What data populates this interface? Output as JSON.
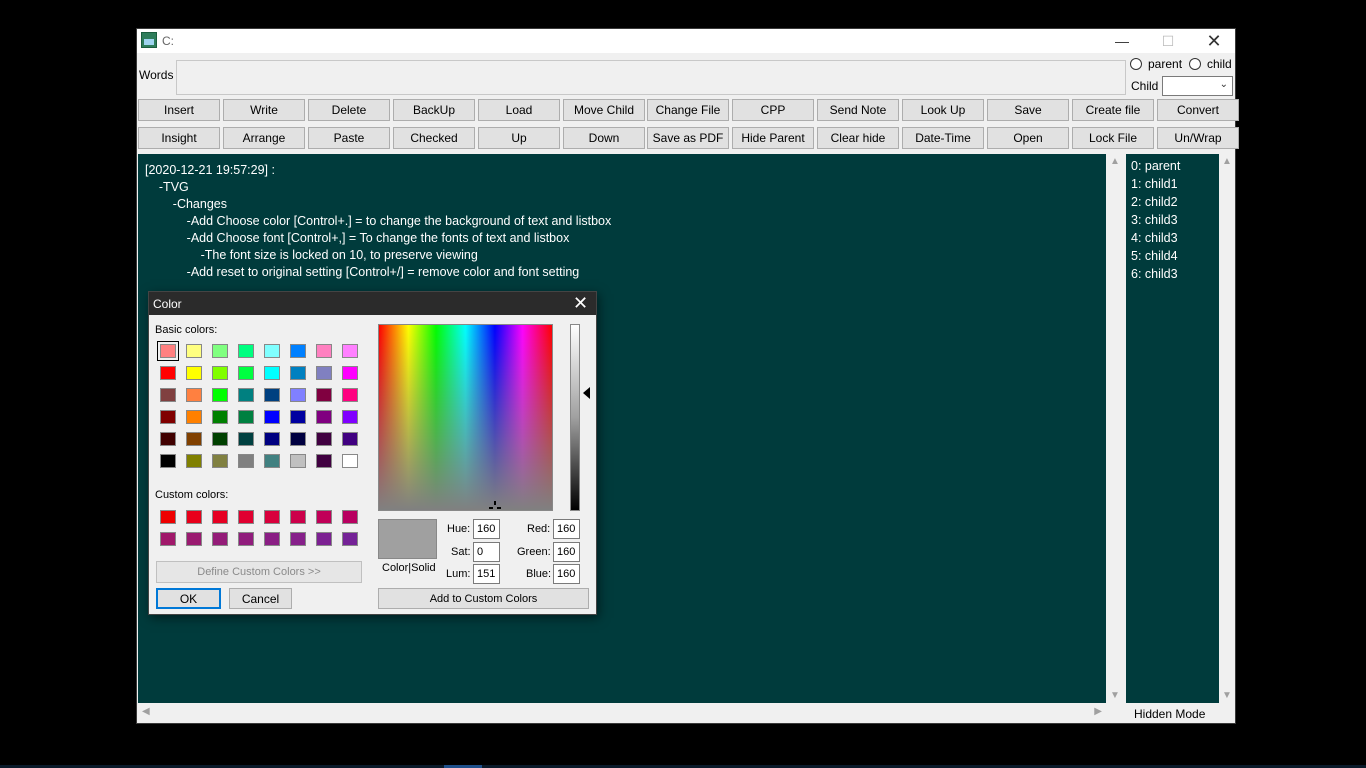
{
  "window": {
    "title": "C:",
    "minimize_glyph": "—",
    "maximize_glyph": "☐",
    "close_glyph": "✕"
  },
  "words": {
    "label": "Words",
    "value": ""
  },
  "radios": {
    "parent": "parent",
    "child": "child"
  },
  "child_select": {
    "label": "Child",
    "value": ""
  },
  "toolbar_row1": [
    "Insert",
    "Write",
    "Delete",
    "BackUp",
    "Load",
    "Move Child",
    "Change File",
    "CPP",
    "Send Note",
    "Look Up",
    "Save",
    "Create file",
    "Convert"
  ],
  "toolbar_row2": [
    "Insight",
    "Arrange",
    "Paste",
    "Checked",
    "Up",
    "Down",
    "Save as PDF",
    "Hide Parent",
    "Clear hide",
    "Date-Time",
    "Open",
    "Lock File",
    "Un/Wrap"
  ],
  "editor": {
    "lines": [
      "[2020-12-21 19:57:29] :",
      "    -TVG",
      "        -Changes",
      "            -Add Choose color [Control+.] = to change the background of text and listbox",
      "            -Add Choose font [Control+,] = To change the fonts of text and listbox",
      "                -The font size is locked on 10, to preserve viewing",
      "            -Add reset to original setting [Control+/] = remove color and font setting"
    ],
    "background": "#003b3c"
  },
  "listbox": {
    "items": [
      "0: parent",
      "1: child1",
      "2: child2",
      "3: child3",
      "4: child3",
      "5: child4",
      "6: child3"
    ]
  },
  "status": {
    "hidden_mode": "Hidden Mode"
  },
  "color_dialog": {
    "title": "Color",
    "close_glyph": "✕",
    "basic_label": "Basic colors:",
    "custom_label": "Custom colors:",
    "basic_colors": [
      [
        "#ff8080",
        "#ffff80",
        "#80ff80",
        "#00ff80",
        "#80ffff",
        "#0080ff",
        "#ff80c0",
        "#ff80ff"
      ],
      [
        "#ff0000",
        "#ffff00",
        "#80ff00",
        "#00ff40",
        "#00ffff",
        "#0080c0",
        "#8080c0",
        "#ff00ff"
      ],
      [
        "#804040",
        "#ff8040",
        "#00ff00",
        "#008080",
        "#004080",
        "#8080ff",
        "#800040",
        "#ff0080"
      ],
      [
        "#800000",
        "#ff8000",
        "#008000",
        "#008040",
        "#0000ff",
        "#0000a0",
        "#800080",
        "#8000ff"
      ],
      [
        "#400000",
        "#804000",
        "#004000",
        "#004040",
        "#000080",
        "#000040",
        "#400040",
        "#400080"
      ],
      [
        "#000000",
        "#808000",
        "#808040",
        "#808080",
        "#408080",
        "#c0c0c0",
        "#400040",
        "#ffffff"
      ]
    ],
    "custom_colors": [
      [
        "#ee0000",
        "#e8001a",
        "#e60022",
        "#e00030",
        "#d8003c",
        "#cc004a",
        "#c00058",
        "#b80060"
      ],
      [
        "#a0186a",
        "#9a1a70",
        "#941c78",
        "#901c7c",
        "#8a1e84",
        "#86208a",
        "#7c2092",
        "#742296"
      ]
    ],
    "define_custom_label": "Define Custom Colors >>",
    "ok_label": "OK",
    "cancel_label": "Cancel",
    "color_solid_label": "Color|Solid",
    "hue_label": "Hue:",
    "hue": "160",
    "sat_label": "Sat:",
    "sat": "0",
    "lum_label": "Lum:",
    "lum": "151",
    "red_label": "Red:",
    "red": "160",
    "green_label": "Green:",
    "green": "160",
    "blue_label": "Blue:",
    "blue": "160",
    "add_custom_label": "Add to Custom Colors",
    "preview_color": "#a0a0a0"
  }
}
